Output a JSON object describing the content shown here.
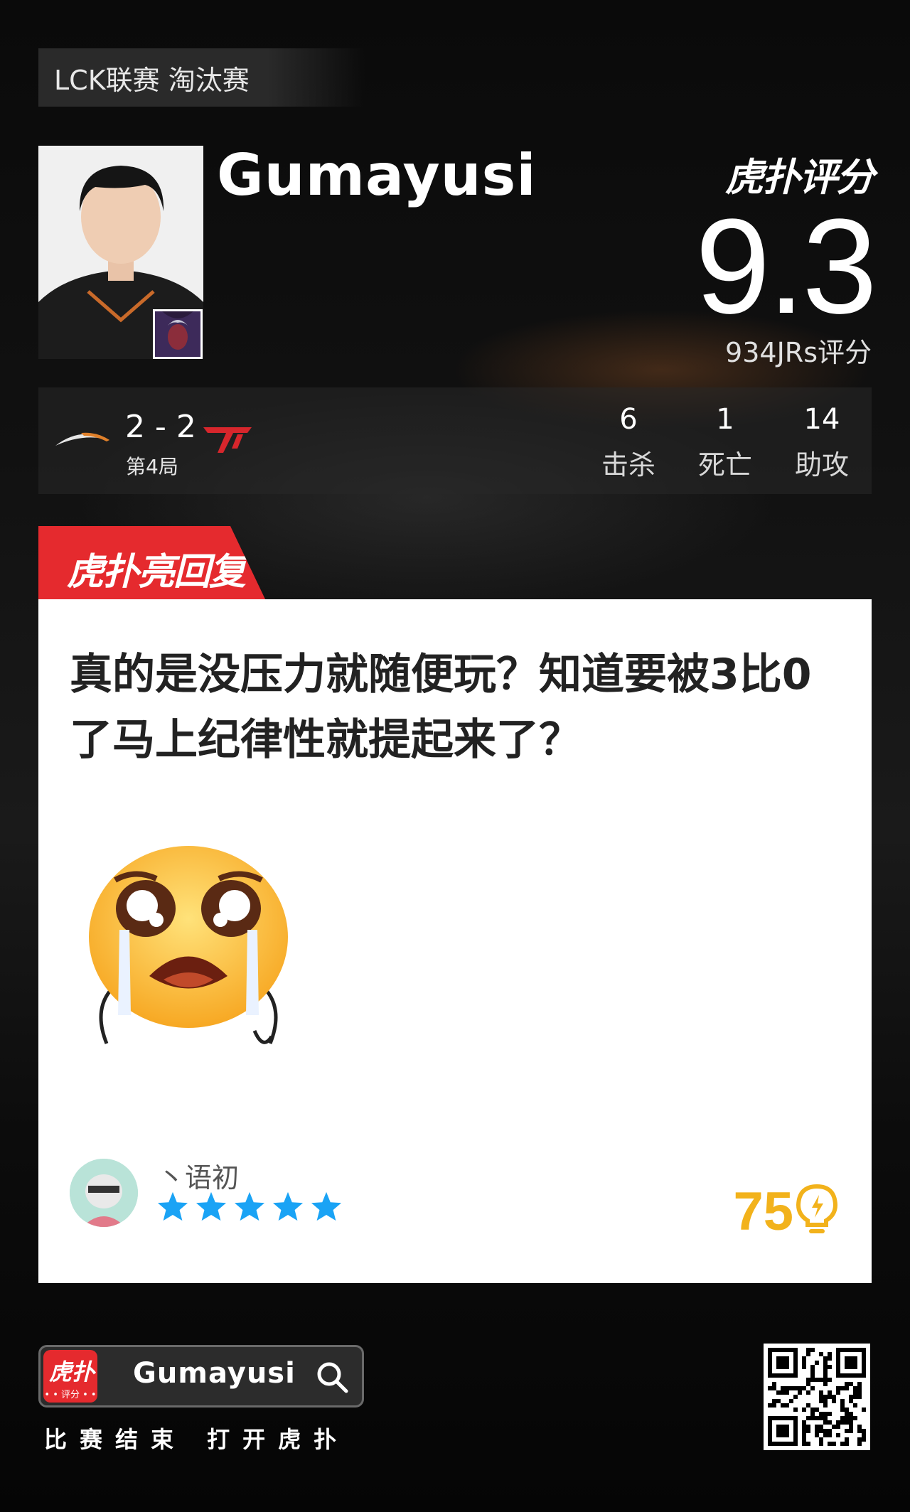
{
  "league_tag": "LCK联赛 淘汰赛",
  "player": {
    "name": "Gumayusi"
  },
  "rating": {
    "brand": "虎扑评分",
    "score": "9.3",
    "votes": "934JRs评分"
  },
  "match": {
    "score": "2 - 2",
    "game": "第4局",
    "stats": [
      {
        "value": "6",
        "label": "击杀"
      },
      {
        "value": "1",
        "label": "死亡"
      },
      {
        "value": "14",
        "label": "助攻"
      }
    ]
  },
  "reply": {
    "tab_label": "虎扑亮回复",
    "comment": "真的是没压力就随便玩？知道要被3比0了马上纪律性就提起来了？",
    "username": "丶语初",
    "stars": 5,
    "likes": "75"
  },
  "footer": {
    "app_icon_label": "虎扑",
    "app_icon_sub": "• • 评分 • •",
    "search_text": "Gumayusi",
    "tagline": "比赛结束 打开虎扑"
  },
  "colors": {
    "accent_red": "#e52a2e",
    "likes_gold": "#f2b21b",
    "star_blue": "#1aa3f5"
  },
  "icons": [
    "search-icon",
    "lightbulb-icon",
    "star-icon",
    "qr-code"
  ]
}
